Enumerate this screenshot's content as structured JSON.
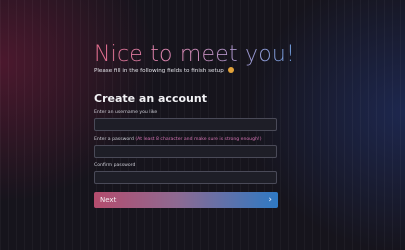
{
  "header": {
    "title": "Nice to meet you!",
    "subtitle": "Please fill in the following fields to finish setup",
    "subtitle_icon": "smiley-emoji-icon"
  },
  "form": {
    "title": "Create an account",
    "username": {
      "label": "Enter an username you like",
      "value": "",
      "placeholder": ""
    },
    "password": {
      "label": "Enter a password",
      "hint": "(At least 8 character and make sure is strong enough!)",
      "value": "",
      "placeholder": ""
    },
    "confirm": {
      "label": "Confirm password",
      "value": "",
      "placeholder": ""
    },
    "next_label": "Next",
    "next_icon": "chevron-right-icon"
  },
  "colors": {
    "background": "#16141c",
    "accent_start": "#b44c6d",
    "accent_end": "#2f79c3",
    "hint": "#d776b7"
  }
}
